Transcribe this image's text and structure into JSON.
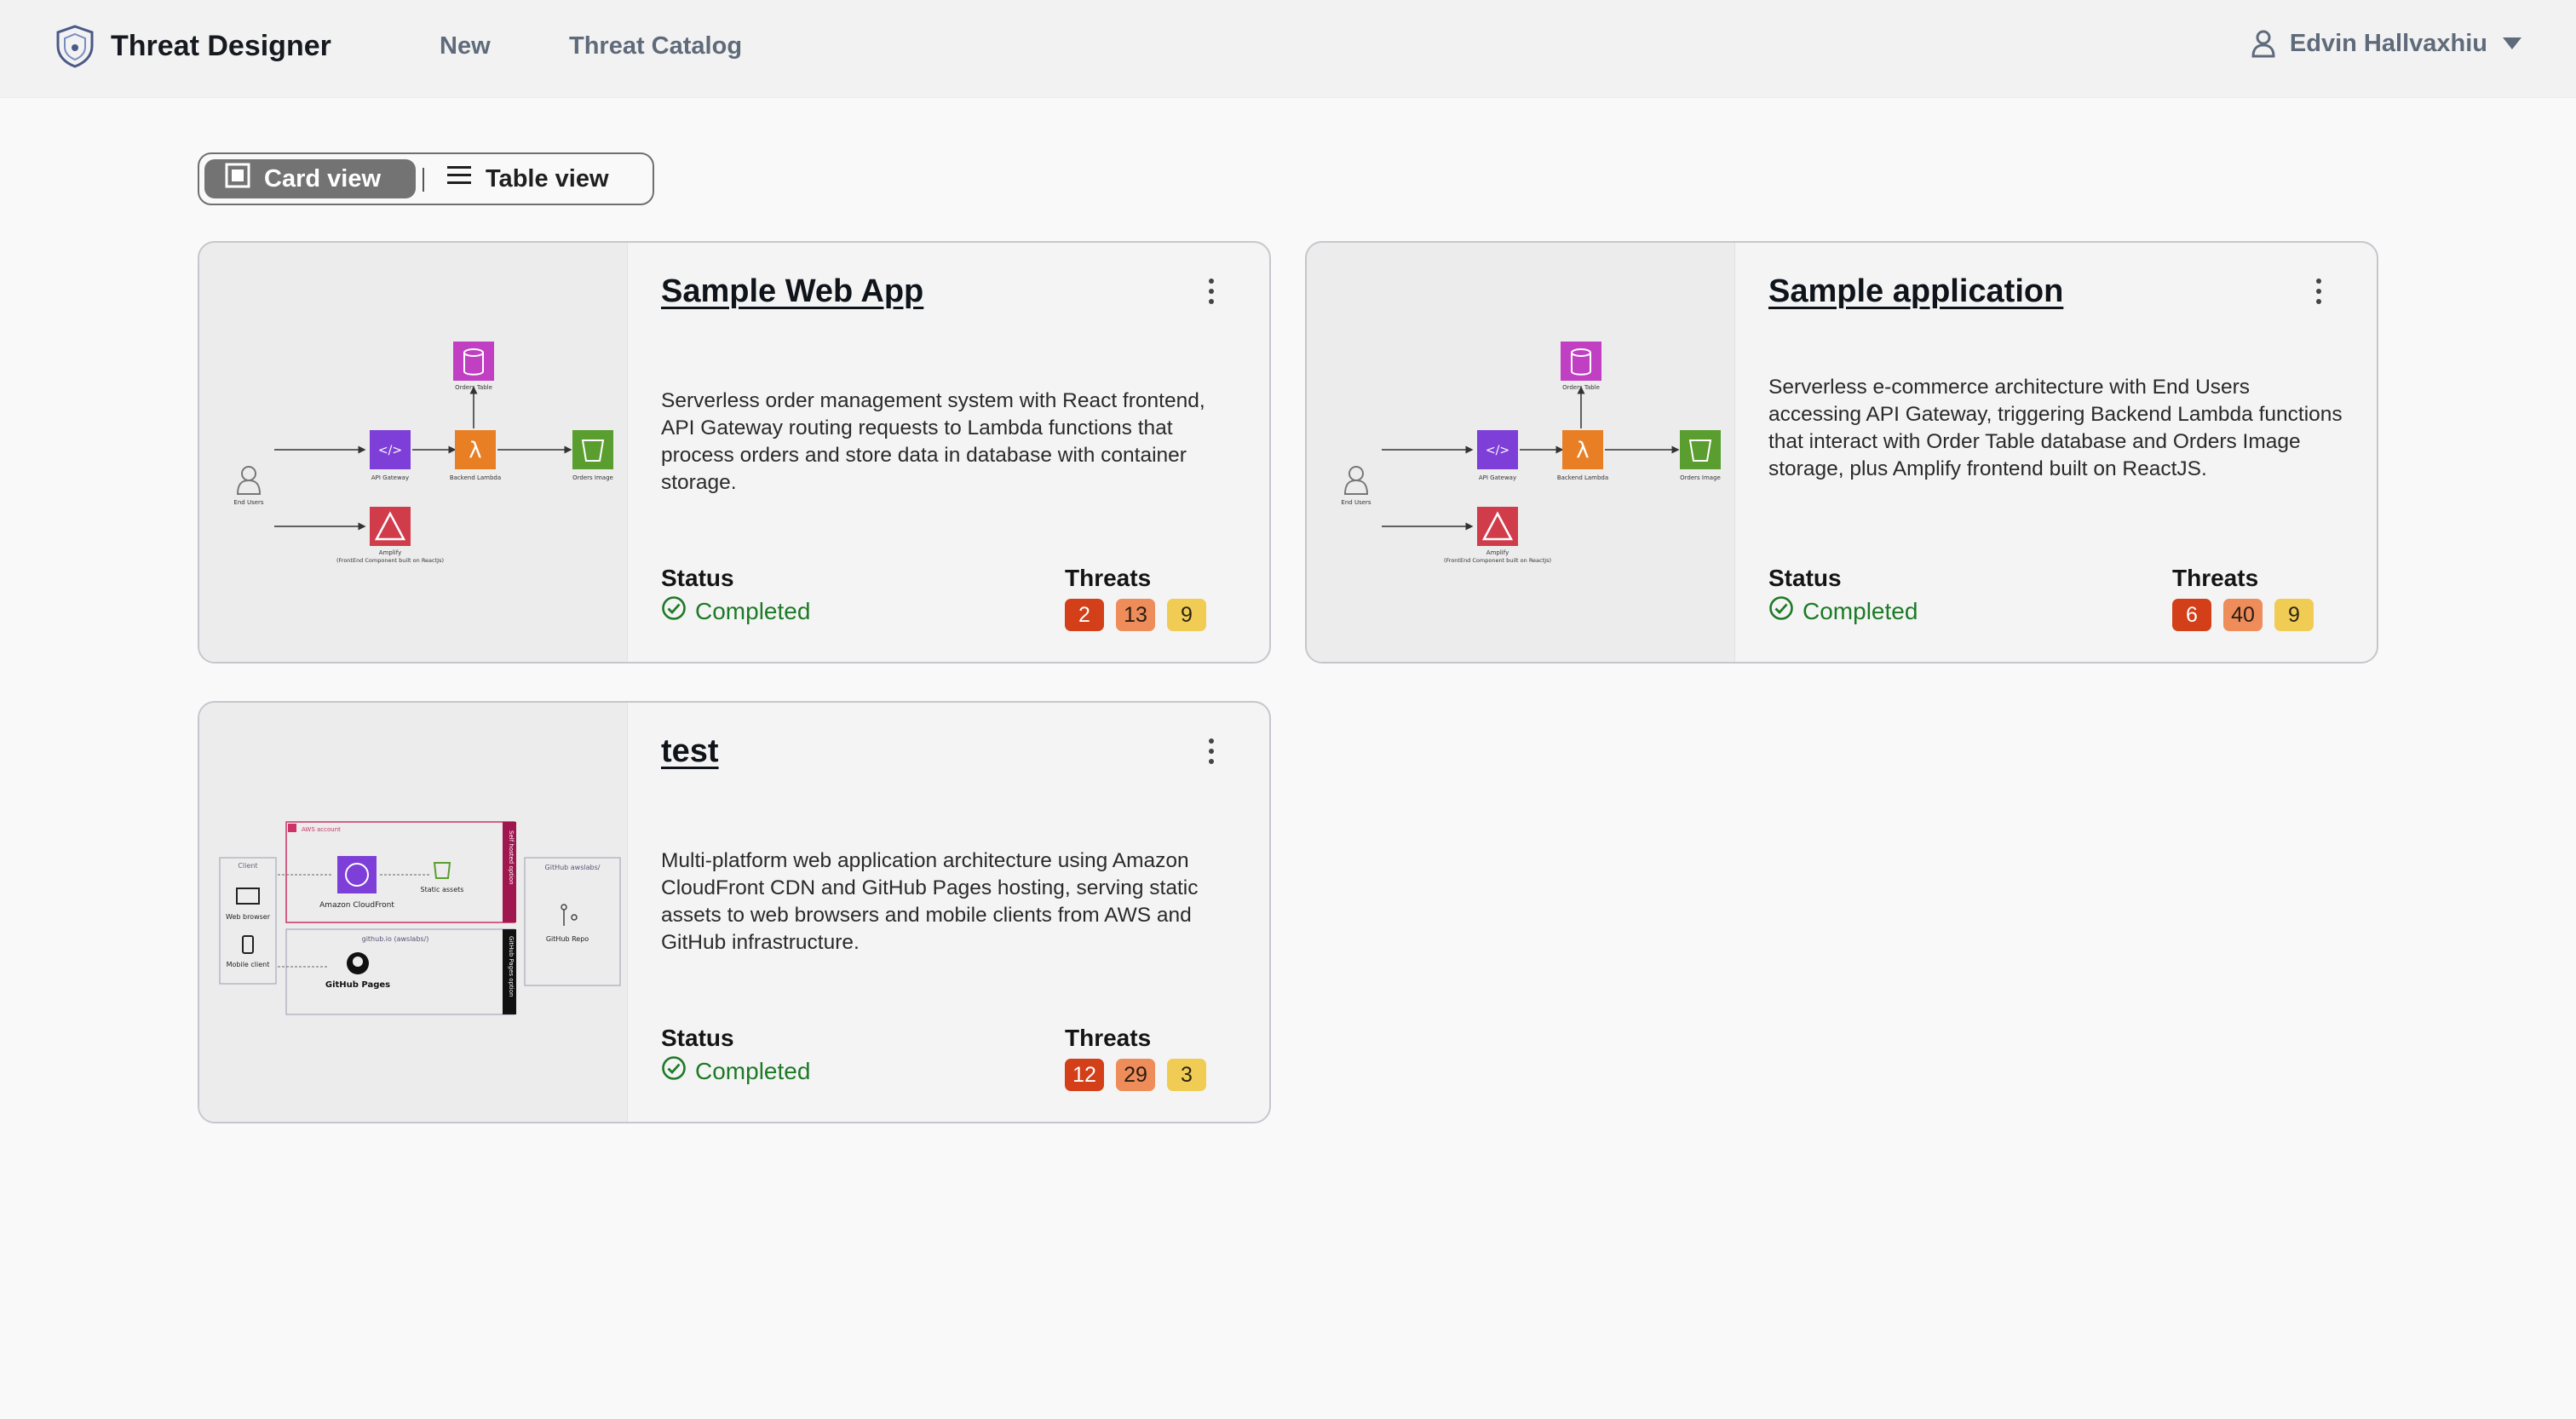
{
  "header": {
    "app_title": "Threat Designer",
    "nav": [
      "New",
      "Threat Catalog"
    ],
    "user_name": "Edvin Hallvaxhiu"
  },
  "view_toggle": {
    "card_label": "Card view",
    "table_label": "Table view",
    "selected": "Card view"
  },
  "status_label": "Status",
  "threats_label": "Threats",
  "severity_colors": {
    "high": "#d23f19",
    "medium": "#ee8c5a",
    "low": "#f0cc54"
  },
  "status_color": "#1d7a26",
  "cards": [
    {
      "title": "Sample Web App",
      "description": "Serverless order management system with React frontend, API Gateway routing requests to Lambda functions that process orders and store data in database with container storage.",
      "status": "Completed",
      "threats": {
        "high": "2",
        "medium": "13",
        "low": "9"
      },
      "diagram": {
        "labels": [
          "End Users",
          "API Gateway",
          "Backend Lambda",
          "Orders Image",
          "Orders Table",
          "Amplify",
          "(FrontEnd Component built on ReactJs)"
        ]
      }
    },
    {
      "title": "Sample application",
      "description": "Serverless e-commerce architecture with End Users accessing API Gateway, triggering Backend Lambda functions that interact with Order Table database and Orders Image storage, plus Amplify frontend built on ReactJS.",
      "status": "Completed",
      "threats": {
        "high": "6",
        "medium": "40",
        "low": "9"
      },
      "diagram": {
        "labels": [
          "End Users",
          "API Gateway",
          "Backend Lambda",
          "Orders Image",
          "Orders Table",
          "Amplify",
          "(FrontEnd Component built on ReactJs)"
        ]
      }
    },
    {
      "title": "test",
      "description": "Multi-platform web application architecture using Amazon CloudFront CDN and GitHub Pages hosting, serving static assets to web browsers and mobile clients from AWS and GitHub infrastructure.",
      "status": "Completed",
      "threats": {
        "high": "12",
        "medium": "29",
        "low": "3"
      },
      "diagram": {
        "labels": [
          "Client",
          "Web browser",
          "Mobile client",
          "AWS account",
          "Amazon CloudFront",
          "Static assets",
          "Self hosted option",
          "github.io (awslabs/)",
          "GitHub Pages",
          "GitHub Pages option",
          "GitHub awslabs/",
          "GitHub Repo"
        ]
      }
    }
  ]
}
